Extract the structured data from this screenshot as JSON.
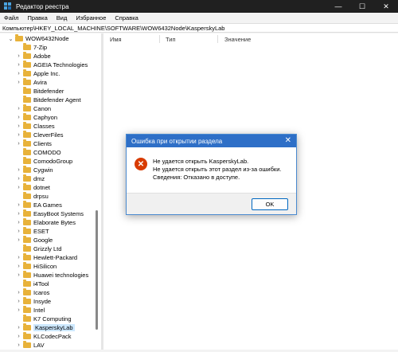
{
  "window": {
    "title": "Редактор реестра",
    "controls": [
      "—",
      "☐",
      "✕"
    ]
  },
  "menu": [
    "Файл",
    "Правка",
    "Вид",
    "Избранное",
    "Справка"
  ],
  "address": "Компьютер\\HKEY_LOCAL_MACHINE\\SOFTWARE\\WOW6432Node\\KasperskyLab",
  "tree": {
    "root": "WOW6432Node",
    "items": [
      {
        "label": "7-Zip",
        "expandable": false
      },
      {
        "label": "Adobe",
        "expandable": true
      },
      {
        "label": "AGEIA Technologies",
        "expandable": true
      },
      {
        "label": "Apple Inc.",
        "expandable": true
      },
      {
        "label": "Avira",
        "expandable": true
      },
      {
        "label": "Bitdefender",
        "expandable": false
      },
      {
        "label": "Bitdefender Agent",
        "expandable": false
      },
      {
        "label": "Canon",
        "expandable": true
      },
      {
        "label": "Caphyon",
        "expandable": true
      },
      {
        "label": "Classes",
        "expandable": true
      },
      {
        "label": "CleverFiles",
        "expandable": true
      },
      {
        "label": "Clients",
        "expandable": true
      },
      {
        "label": "COMODO",
        "expandable": false
      },
      {
        "label": "ComodoGroup",
        "expandable": false
      },
      {
        "label": "Cygwin",
        "expandable": true
      },
      {
        "label": "dmz",
        "expandable": true
      },
      {
        "label": "dotnet",
        "expandable": true
      },
      {
        "label": "drpsu",
        "expandable": false
      },
      {
        "label": "EA Games",
        "expandable": true
      },
      {
        "label": "EasyBoot Systems",
        "expandable": true
      },
      {
        "label": "Elaborate Bytes",
        "expandable": true
      },
      {
        "label": "ESET",
        "expandable": true
      },
      {
        "label": "Google",
        "expandable": true
      },
      {
        "label": "Grizzly Ltd",
        "expandable": false
      },
      {
        "label": "Hewlett-Packard",
        "expandable": true
      },
      {
        "label": "HiSilicon",
        "expandable": true
      },
      {
        "label": "Huawei technologies",
        "expandable": true
      },
      {
        "label": "i4Tool",
        "expandable": false
      },
      {
        "label": "Icaros",
        "expandable": true
      },
      {
        "label": "Insyde",
        "expandable": true
      },
      {
        "label": "Intel",
        "expandable": true
      },
      {
        "label": "K7 Computing",
        "expandable": false
      },
      {
        "label": "KasperskyLab",
        "expandable": true,
        "selected": true
      },
      {
        "label": "KLCodecPack",
        "expandable": true
      },
      {
        "label": "LAV",
        "expandable": true
      }
    ]
  },
  "columns": [
    "Имя",
    "Тип",
    "Значение"
  ],
  "dialog": {
    "title": "Ошибка при открытии раздела",
    "lines": [
      "Не удается открыть KasperskyLab.",
      "Не удается открыть этот раздел из-за ошибки.",
      "Сведения: Отказано в доступе."
    ],
    "ok": "OK"
  }
}
